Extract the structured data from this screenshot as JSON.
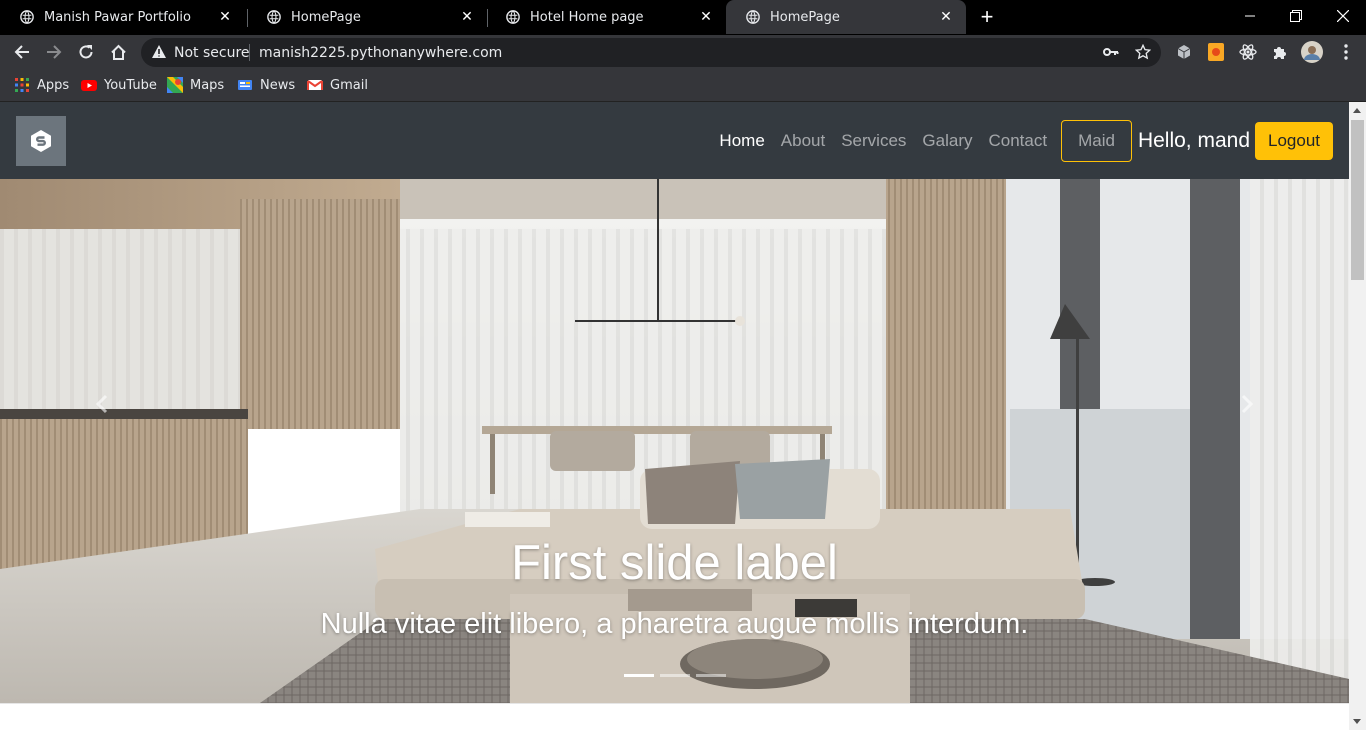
{
  "browser": {
    "tabs": [
      {
        "title": "Manish Pawar Portfolio",
        "active": false
      },
      {
        "title": "HomePage",
        "active": false
      },
      {
        "title": "Hotel Home page",
        "active": false
      },
      {
        "title": "HomePage",
        "active": true
      }
    ],
    "security_label": "Not secure",
    "url": "manish2225.pythonanywhere.com",
    "bookmarks": [
      "Apps",
      "YouTube",
      "Maps",
      "News",
      "Gmail"
    ]
  },
  "navbar": {
    "links": [
      "Home",
      "About",
      "Services",
      "Galary",
      "Contact"
    ],
    "active_link": "Home",
    "maid_label": "Maid",
    "greeting": "Hello, mand",
    "logout_label": "Logout"
  },
  "carousel": {
    "title": "First slide label",
    "text": "Nulla vitae elit libero, a pharetra augue mollis interdum.",
    "slide_count": 3,
    "active_slide": 1
  },
  "colors": {
    "navbar_bg": "#343a40",
    "accent": "#ffc107",
    "chrome_bg": "#35363a"
  }
}
